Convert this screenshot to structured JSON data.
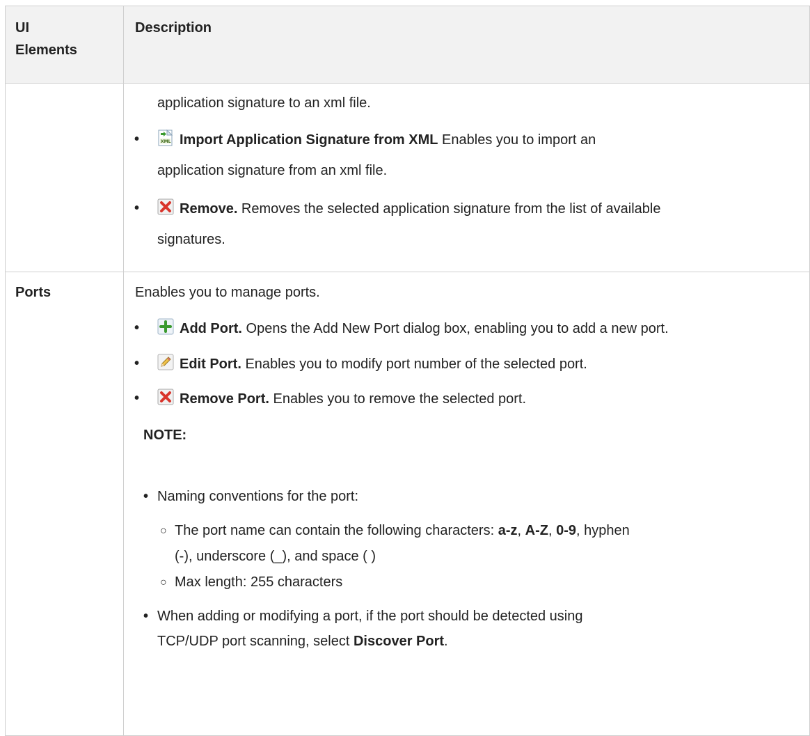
{
  "table": {
    "header_col1_line1": "UI",
    "header_col1_line2": "Elements",
    "header_col2": "Description"
  },
  "row1": {
    "cont_text": "application signature to an xml file.",
    "import_title": "Import Application Signature from XML",
    "import_desc_1": " Enables you to import an",
    "import_desc_2": "application signature from an xml file.",
    "remove_title": "Remove.",
    "remove_desc_1": " Removes the selected application signature from the list of available",
    "remove_desc_2": "signatures."
  },
  "row2": {
    "label": "Ports",
    "intro": "Enables you to manage ports.",
    "add_title": "Add Port.",
    "add_desc": " Opens the Add New Port dialog box, enabling you to add a new port.",
    "edit_title": "Edit Port.",
    "edit_desc": " Enables you to modify port number of the selected port.",
    "remove_title": "Remove Port.",
    "remove_desc": " Enables you to remove the selected port.",
    "note_label": "NOTE:",
    "naming": "Naming conventions for the port:",
    "chars_prefix": "The port name can contain the following characters: ",
    "chars_az": "a-z",
    "sep1": ", ",
    "chars_AZ": "A-Z",
    "sep2": ", ",
    "chars_09": "0-9",
    "chars_rest": ", hyphen",
    "chars_line2": "(-), underscore (_), and space ( )",
    "maxlen": "Max length: 255 characters",
    "when_1": "When adding or modifying a port, if the port should be detected using",
    "when_2_prefix": "TCP/UDP port scanning, select ",
    "when_2_bold": "Discover Port",
    "when_2_suffix": "."
  },
  "icons": {
    "import": "import-xml-icon",
    "remove": "remove-x-icon",
    "add": "add-plus-icon",
    "edit": "edit-pencil-icon"
  },
  "colors": {
    "header_bg": "#f2f2f2",
    "border": "#cfcfcf",
    "remove_icon": "#d9342b",
    "add_icon": "#3a9a2e"
  }
}
